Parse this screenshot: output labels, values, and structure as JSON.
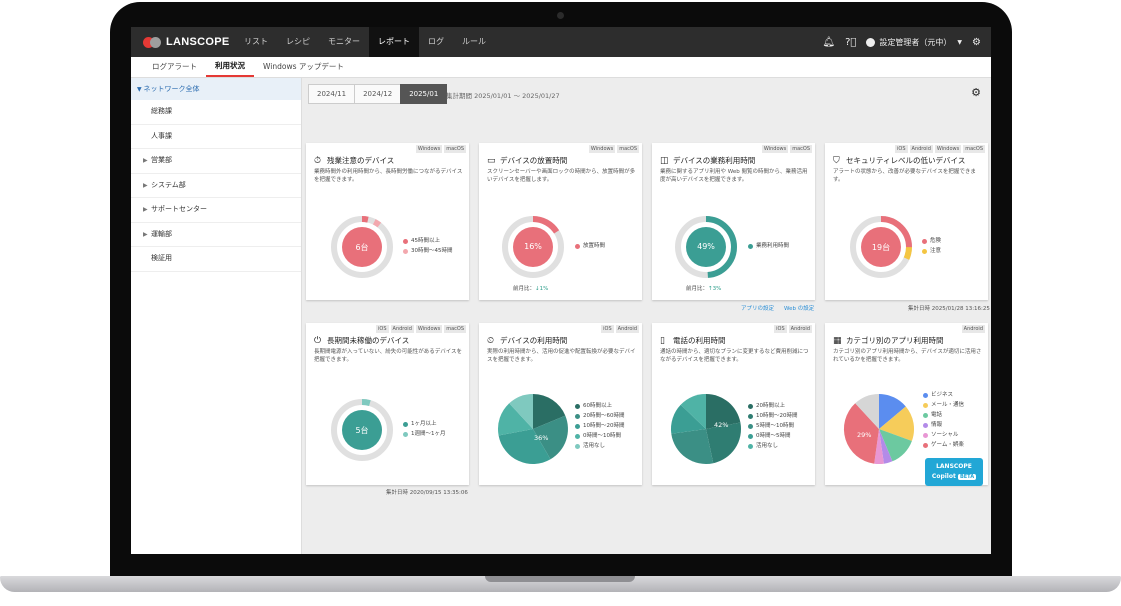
{
  "app": {
    "logo": "LANSCOPE"
  },
  "nav": [
    "リスト",
    "レシピ",
    "モニター",
    "レポート",
    "ログ",
    "ルール"
  ],
  "user": {
    "name": "設定管理者（元中）"
  },
  "subtabs": [
    "ログアラート",
    "利用状況",
    "Windows アップデート"
  ],
  "sidebar": {
    "head": "ネットワーク全体",
    "items": [
      "総務課",
      "人事課",
      "営業部",
      "システム部",
      "サポートセンター",
      "運輸部",
      "検証用"
    ]
  },
  "months": [
    "2024/11",
    "2024/12",
    "2025/01"
  ],
  "period": "集計期間  2025/01/01 ～ 2025/01/27",
  "cards": [
    {
      "tags": [
        "Windows",
        "macOS"
      ],
      "title": "残業注意のデバイス",
      "desc": "業務時間外の利用時間から、長時間労働につながるデバイスを把握できます。",
      "center": "6台",
      "legend": [
        "45時間以上",
        "30時間～45時間"
      ]
    },
    {
      "tags": [
        "Windows",
        "macOS"
      ],
      "title": "デバイスの放置時間",
      "desc": "スクリーンセーバーや画面ロックの時間から、放置時間が多いデバイスを把握します。",
      "center": "16%",
      "legend": [
        "放置時間"
      ],
      "compare_label": "前月比：",
      "compare_value": "↓1%"
    },
    {
      "tags": [
        "Windows",
        "macOS"
      ],
      "title": "デバイスの業務利用時間",
      "desc": "業務に関するアプリ利用や Web 閲覧の時間から、業務活用度が高いデバイスを把握できます。",
      "center": "49%",
      "legend": [
        "業務利用時間"
      ],
      "compare_label": "前月比：",
      "compare_value": "↑3%",
      "links": [
        "アプリの設定",
        "Web の設定"
      ]
    },
    {
      "tags": [
        "iOS",
        "Android",
        "Windows",
        "macOS"
      ],
      "title": "セキュリティレベルの低いデバイス",
      "desc": "アラートの状態から、改善が必要なデバイスを把握できます。",
      "center": "19台",
      "legend": [
        "危険",
        "注意"
      ],
      "footer": "集計日時  2025/01/28 13:16:25"
    },
    {
      "tags": [
        "iOS",
        "Android",
        "Windows",
        "macOS"
      ],
      "title": "長期間未稼働のデバイス",
      "desc": "長期間電源が入っていない、紛失の可能性があるデバイスを把握できます。",
      "center": "5台",
      "legend": [
        "1ヶ月以上",
        "1週間～1ヶ月"
      ],
      "footer": "集計日時  2020/09/15 13:35:06"
    },
    {
      "tags": [
        "iOS",
        "Android"
      ],
      "title": "デバイスの利用時間",
      "desc": "実際の利用時間から、活用の促進や配置転換が必要なデバイスを把握できます。",
      "center": "36%",
      "legend": [
        "60時間以上",
        "20時間～60時間",
        "10時間～20時間",
        "0時間～10時間",
        "活用なし"
      ]
    },
    {
      "tags": [
        "iOS",
        "Android"
      ],
      "title": "電話の利用時間",
      "desc": "通話の時間から、適切なプランに変更するなど費用削減につながるデバイスを把握できます。",
      "center": "42%",
      "legend": [
        "20時間以上",
        "10時間～20時間",
        "5時間～10時間",
        "0時間～5時間",
        "活用なし"
      ]
    },
    {
      "tags": [
        "Android"
      ],
      "title": "カテゴリ別のアプリ利用時間",
      "desc": "カテゴリ別のアプリ利用時間から、デバイスが適切に活用されているかを把握できます。",
      "center": "29%",
      "legend": [
        "ビジネス",
        "メール・通信",
        "電話",
        "情報",
        "ソーシャル",
        "ゲーム・娯楽"
      ]
    }
  ],
  "copilot": {
    "line1": "LANSCOPE",
    "line2": "Copilot",
    "beta": "BETA"
  },
  "colors": {
    "accent": "#e53935",
    "pink": "#e8707a",
    "teal": "#3b9e94",
    "dark_teal": "#2a6e64"
  }
}
